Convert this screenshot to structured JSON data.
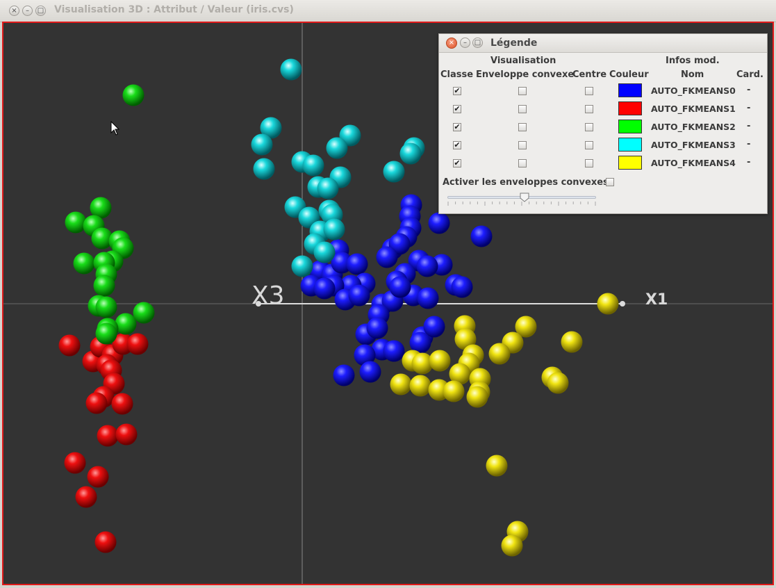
{
  "window": {
    "title": "Visualisation 3D : Attribut / Valeur (iris.cvs)",
    "close_glyph": "×",
    "minimize_glyph": "–",
    "maximize_glyph": "□"
  },
  "plot": {
    "axis_x_label": "X1",
    "axis_z_label": "X3",
    "background": "#333333",
    "border_color": "#e01a1a"
  },
  "legend": {
    "title": "Légende",
    "group_visualisation": "Visualisation",
    "group_infos": "Infos mod.",
    "col_classe": "Classe",
    "col_enveloppe": "Enveloppe convexe",
    "col_centre": "Centre",
    "col_couleur": "Couleur",
    "col_nom": "Nom",
    "col_card": "Card.",
    "check_glyph": "✔",
    "rows": [
      {
        "name": "AUTO_FKMEANS0",
        "color": "#0000ff",
        "classe_checked": true,
        "enveloppe_checked": false,
        "centre_checked": false,
        "card": "-"
      },
      {
        "name": "AUTO_FKMEANS1",
        "color": "#ff0000",
        "classe_checked": true,
        "enveloppe_checked": false,
        "centre_checked": false,
        "card": "-"
      },
      {
        "name": "AUTO_FKMEANS2",
        "color": "#00ff00",
        "classe_checked": true,
        "enveloppe_checked": false,
        "centre_checked": false,
        "card": "-"
      },
      {
        "name": "AUTO_FKMEANS3",
        "color": "#00ffff",
        "classe_checked": true,
        "enveloppe_checked": false,
        "centre_checked": false,
        "card": "-"
      },
      {
        "name": "AUTO_FKMEANS4",
        "color": "#ffff00",
        "classe_checked": true,
        "enveloppe_checked": false,
        "centre_checked": false,
        "card": "-"
      }
    ],
    "toggle_label": "Activer les enveloppes convexes",
    "toggle_checked": false,
    "slider_value": 0.52
  }
}
